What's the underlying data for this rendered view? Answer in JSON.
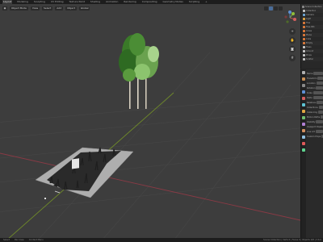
{
  "topbar": {
    "tabs": [
      "Layout",
      "Modeling",
      "Sculpting",
      "UV Editing",
      "Texture Paint",
      "Shading",
      "Animation",
      "Rendering",
      "Compositing",
      "Geometry Nodes",
      "Scripting",
      "+"
    ],
    "active_index": 0
  },
  "viewport": {
    "mode_label": "Object Mode",
    "view_menu": "View",
    "select_menu": "Select",
    "add_menu": "Add",
    "object_menu": "Object",
    "transform_label": "Global"
  },
  "outliner": {
    "header_label": "Scene Collection",
    "items": [
      {
        "label": "Collection",
        "color": "#c9c9c9"
      },
      {
        "label": "Camera",
        "color": "#6fa9d8"
      },
      {
        "label": "Light",
        "color": "#e0a642"
      },
      {
        "label": "Tree",
        "color": "#e07b3a"
      },
      {
        "label": "Tree.001",
        "color": "#e07b3a"
      },
      {
        "label": "Grass",
        "color": "#e07b3a"
      },
      {
        "label": "Plane",
        "color": "#e07b3a"
      },
      {
        "label": "Cube",
        "color": "#e07b3a"
      },
      {
        "label": "Empty",
        "color": "#e07b3a"
      },
      {
        "label": "Trees",
        "color": "#c9c9c9"
      },
      {
        "label": "Ground",
        "color": "#c9c9c9"
      },
      {
        "label": "Props",
        "color": "#c9c9c9"
      },
      {
        "label": "Scatter",
        "color": "#c9c9c9"
      }
    ]
  },
  "properties": {
    "tab_colors": [
      "#b0b0b0",
      "#c98f55",
      "#8a8a8a",
      "#5e8fd3",
      "#d35e5e",
      "#5ec3d3",
      "#e0a642",
      "#6fbf6f",
      "#b07fd3",
      "#d38f5e",
      "#8fbfe0",
      "#e05a5a",
      "#5ed38f"
    ],
    "rows": [
      "Name",
      "Transform",
      "Location",
      "Rotation",
      "Scale",
      "Delta",
      "Relations",
      "Collections",
      "Instancing",
      "Motion Paths",
      "Visibility",
      "Viewport Display",
      "Line Art",
      "Custom Props"
    ]
  },
  "statusbar": {
    "left_items": [
      "Select",
      "Pan View",
      "Context Menu"
    ],
    "right_text": "Scene Collection | Verts 0 | Faces 0 | Objects 0/8 | 3.6.0"
  },
  "colors": {
    "viewport_bg": "#3d3d3d",
    "grid": "#474747",
    "axis_x": "#8a3a45",
    "axis_y": "#6f8a2a",
    "accent": "#4a6d9a"
  },
  "icons": {
    "gizmo": "navigation-gizmo-icon",
    "zoom": "zoom-icon",
    "pan": "hand-pan-icon",
    "camera": "camera-view-icon",
    "ortho": "grid-ortho-icon"
  }
}
